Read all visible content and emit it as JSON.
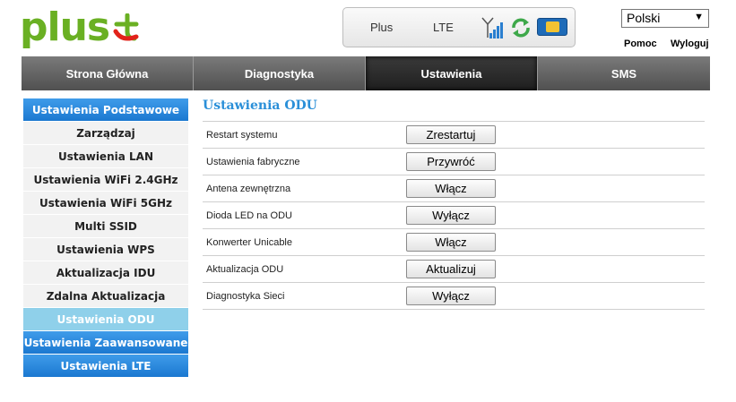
{
  "brand": {
    "logo_text": "plus"
  },
  "status": {
    "carrier": "Plus",
    "network": "LTE",
    "sim_label": "USIM"
  },
  "header": {
    "language": "Polski",
    "help": "Pomoc",
    "logout": "Wyloguj"
  },
  "nav": [
    {
      "label": "Strona Główna"
    },
    {
      "label": "Diagnostyka"
    },
    {
      "label": "Ustawienia"
    },
    {
      "label": "SMS"
    }
  ],
  "sidebar": [
    {
      "label": "Ustawienia Podstawowe"
    },
    {
      "label": "Zarządzaj"
    },
    {
      "label": "Ustawienia LAN"
    },
    {
      "label": "Ustawienia WiFi 2.4GHz"
    },
    {
      "label": "Ustawienia WiFi 5GHz"
    },
    {
      "label": "Multi SSID"
    },
    {
      "label": "Ustawienia WPS"
    },
    {
      "label": "Aktualizacja IDU"
    },
    {
      "label": "Zdalna Aktualizacja"
    },
    {
      "label": "Ustawienia ODU"
    },
    {
      "label": "Ustawienia Zaawansowane"
    },
    {
      "label": "Ustawienia LTE"
    }
  ],
  "content": {
    "title": "Ustawienia ODU",
    "rows": [
      {
        "label": "Restart systemu",
        "button": "Zrestartuj"
      },
      {
        "label": "Ustawienia fabryczne",
        "button": "Przywróć"
      },
      {
        "label": "Antena zewnętrzna",
        "button": "Włącz"
      },
      {
        "label": "Dioda LED na ODU",
        "button": "Wyłącz"
      },
      {
        "label": "Konwerter Unicable",
        "button": "Włącz"
      },
      {
        "label": "Aktualizacja ODU",
        "button": "Aktualizuj"
      },
      {
        "label": "Diagnostyka Sieci",
        "button": "Wyłącz"
      }
    ]
  },
  "colors": {
    "brand_green": "#6ab023",
    "brand_red": "#e2231a",
    "accent_blue": "#2a8fd8",
    "active_light_blue": "#8fd0ea"
  }
}
